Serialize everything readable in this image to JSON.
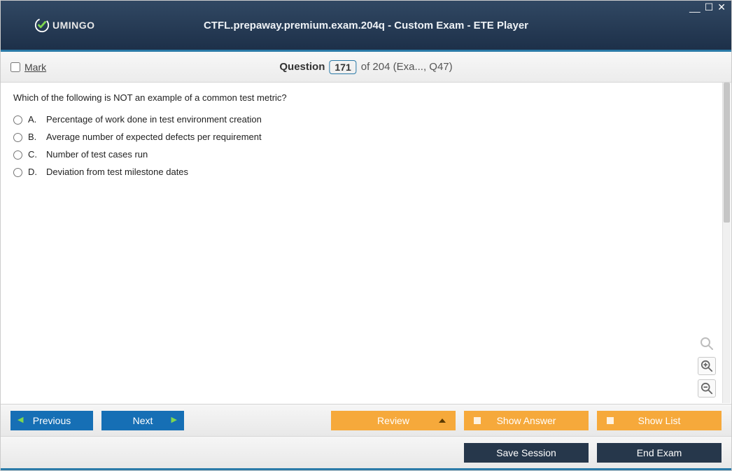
{
  "header": {
    "logo_text": "UMINGO",
    "title": "CTFL.prepaway.premium.exam.204q - Custom Exam - ETE Player"
  },
  "questionbar": {
    "mark_label": "Mark",
    "question_label": "Question",
    "current_number": "171",
    "total_suffix": "of 204 (Exa..., Q47)"
  },
  "question": {
    "text": "Which of the following is NOT an example of a common test metric?",
    "options": [
      {
        "letter": "A.",
        "text": "Percentage of work done in test environment creation"
      },
      {
        "letter": "B.",
        "text": "Average number of expected defects per requirement"
      },
      {
        "letter": "C.",
        "text": "Number of test cases run"
      },
      {
        "letter": "D.",
        "text": "Deviation from test milestone dates"
      }
    ]
  },
  "footer": {
    "previous": "Previous",
    "next": "Next",
    "review": "Review",
    "show_answer": "Show Answer",
    "show_list": "Show List",
    "save_session": "Save Session",
    "end_exam": "End Exam"
  }
}
